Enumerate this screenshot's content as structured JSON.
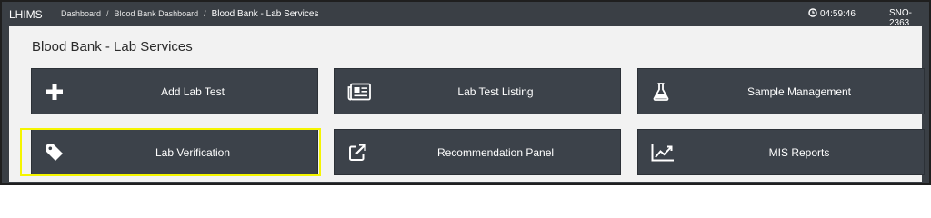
{
  "app": {
    "brand": "LHIMS"
  },
  "breadcrumb": {
    "items": [
      "Dashboard",
      "Blood Bank Dashboard",
      "Blood Bank - Lab Services"
    ],
    "separator": "/"
  },
  "status": {
    "time": "04:59:46",
    "serial": "SNO-2363"
  },
  "page": {
    "title": "Blood Bank - Lab Services"
  },
  "tiles": [
    {
      "label": "Add Lab Test",
      "icon": "plus-icon"
    },
    {
      "label": "Lab Test Listing",
      "icon": "newspaper-icon"
    },
    {
      "label": "Sample Management",
      "icon": "flask-icon"
    },
    {
      "label": "Lab Verification",
      "icon": "tag-icon"
    },
    {
      "label": "Recommendation Panel",
      "icon": "external-link-icon"
    },
    {
      "label": "MIS Reports",
      "icon": "line-chart-icon"
    }
  ],
  "colors": {
    "bar": "#3a3f45",
    "tile": "#3c424a",
    "panel": "#f2f2f2",
    "highlight": "#f5f500"
  }
}
